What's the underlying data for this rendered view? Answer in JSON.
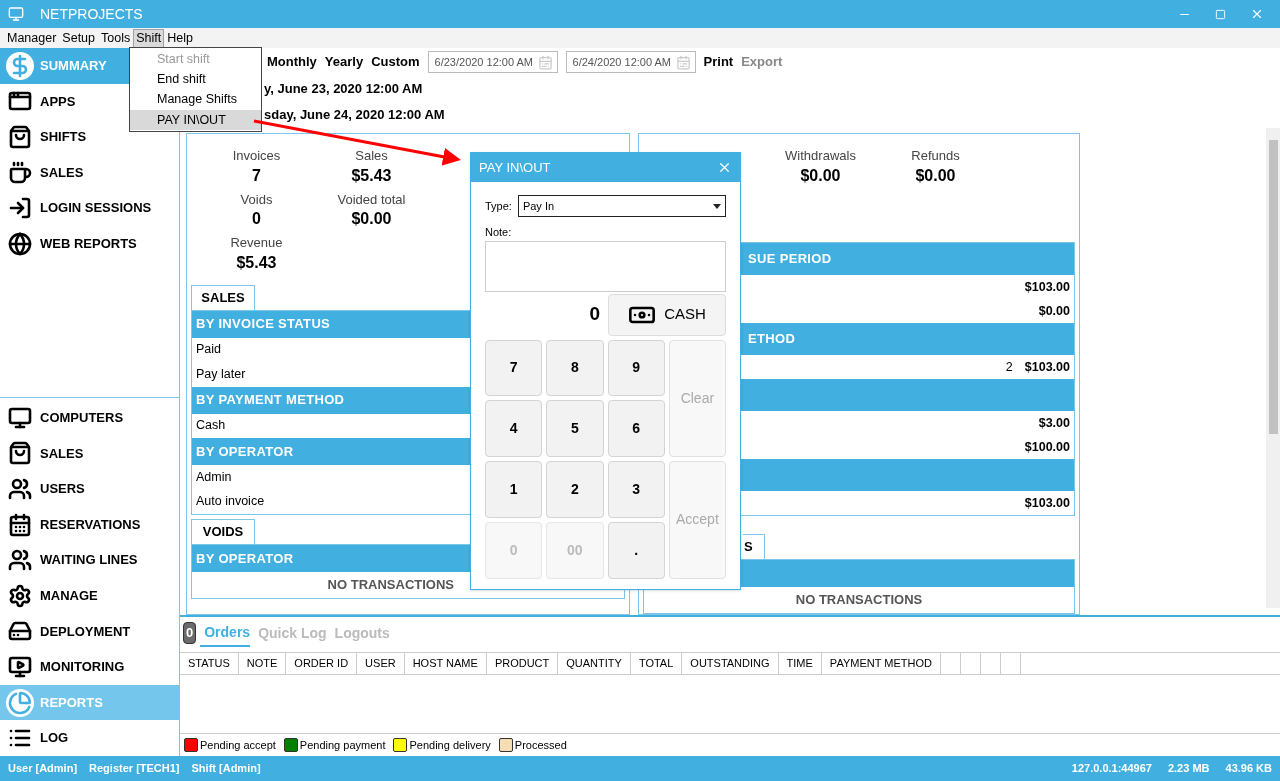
{
  "window": {
    "title": "NETPROJECTS"
  },
  "menu_bar": [
    {
      "label": "Manager",
      "selected": false
    },
    {
      "label": "Setup",
      "selected": false
    },
    {
      "label": "Tools",
      "selected": false
    },
    {
      "label": "Shift",
      "selected": true
    },
    {
      "label": "Help",
      "selected": false
    }
  ],
  "shift_menu": [
    {
      "label": "Start shift",
      "disabled": true,
      "selected": false
    },
    {
      "label": "End shift",
      "disabled": false,
      "selected": false
    },
    {
      "label": "Manage Shifts",
      "disabled": false,
      "selected": false
    },
    {
      "label": "PAY IN\\OUT",
      "disabled": false,
      "selected": true
    }
  ],
  "sidebar": {
    "top_items": [
      {
        "label": "SUMMARY",
        "selected": true
      },
      {
        "label": "APPS",
        "selected": false
      },
      {
        "label": "SHIFTS",
        "selected": false
      },
      {
        "label": "SALES",
        "selected": false
      },
      {
        "label": "LOGIN SESSIONS",
        "selected": false
      },
      {
        "label": "WEB REPORTS",
        "selected": false
      }
    ],
    "bottom_items": [
      {
        "label": "COMPUTERS",
        "selected": false
      },
      {
        "label": "SALES",
        "selected": false
      },
      {
        "label": "USERS",
        "selected": false
      },
      {
        "label": "RESERVATIONS",
        "selected": false
      },
      {
        "label": "WAITING LINES",
        "selected": false
      },
      {
        "label": "MANAGE",
        "selected": false
      },
      {
        "label": "DEPLOYMENT",
        "selected": false
      },
      {
        "label": "MONITORING",
        "selected": false
      },
      {
        "label": "REPORTS",
        "selected": true
      },
      {
        "label": "LOG",
        "selected": false
      }
    ]
  },
  "toolbar": {
    "periods": [
      "Monthly",
      "Yearly",
      "Custom"
    ],
    "start_date": "6/23/2020 12:00 AM",
    "end_date": "6/24/2020 12:00 AM",
    "actions": [
      {
        "label": "Print",
        "disabled": false
      },
      {
        "label": "Export",
        "disabled": true
      }
    ]
  },
  "period_lines": [
    "y, June 23, 2020 12:00 AM",
    "sday, June 24, 2020 12:00 AM"
  ],
  "left_panel": {
    "stats": [
      [
        {
          "label": "Invoices",
          "value": "7"
        },
        {
          "label": "Sales",
          "value": "$5.43"
        }
      ],
      [
        {
          "label": "Voids",
          "value": "0"
        },
        {
          "label": "Voided total",
          "value": "$0.00"
        }
      ],
      [
        {
          "label": "Revenue",
          "value": "$5.43"
        }
      ]
    ],
    "sections": [
      {
        "tab": "SALES",
        "groups": [
          {
            "title": "BY INVOICE STATUS",
            "rows": [
              "Paid",
              "Pay later"
            ]
          },
          {
            "title": "BY PAYMENT METHOD",
            "rows": [
              "Cash"
            ]
          },
          {
            "title": "BY OPERATOR",
            "rows": [
              "Admin",
              "Auto invoice"
            ]
          }
        ]
      },
      {
        "tab": "VOIDS",
        "groups": [
          {
            "title": "BY OPERATOR"
          }
        ],
        "empty": "NO TRANSACTIONS"
      }
    ]
  },
  "right_panel": {
    "stats": [
      {
        "label": "Withdrawals",
        "value": "$0.00"
      },
      {
        "label": "Refunds",
        "value": "$0.00"
      }
    ],
    "groups": [
      {
        "title": "SUE PERIOD",
        "rows": [
          [
            "$103.00"
          ],
          [
            "$0.00"
          ]
        ]
      },
      {
        "title": "ETHOD",
        "rows": [
          [
            "2",
            "$103.00"
          ]
        ]
      },
      {
        "rows": [
          [
            "$3.00"
          ],
          [
            "$100.00"
          ]
        ]
      },
      {
        "rows": [
          [
            "$103.00"
          ]
        ]
      }
    ],
    "second_section": {
      "tab": "S",
      "empty": "NO TRANSACTIONS"
    }
  },
  "dialog": {
    "title": "PAY IN\\OUT",
    "type_label": "Type:",
    "type_value": "Pay In",
    "note_label": "Note:",
    "amount": "0",
    "cash_button": "CASH",
    "keys": [
      {
        "label": "7",
        "disabled": false
      },
      {
        "label": "8",
        "disabled": false
      },
      {
        "label": "9",
        "disabled": false
      },
      {
        "label": "4",
        "disabled": false
      },
      {
        "label": "5",
        "disabled": false
      },
      {
        "label": "6",
        "disabled": false
      },
      {
        "label": "1",
        "disabled": false
      },
      {
        "label": "2",
        "disabled": false
      },
      {
        "label": "3",
        "disabled": false
      },
      {
        "label": "0",
        "disabled": true
      },
      {
        "label": "00",
        "disabled": true
      },
      {
        "label": ".",
        "disabled": false
      }
    ],
    "clear": {
      "label": "Clear",
      "disabled": true
    },
    "accept": {
      "label": "Accept",
      "disabled": true
    }
  },
  "log_tabs": {
    "count": "0",
    "tabs": [
      {
        "label": "Orders",
        "selected": true
      },
      {
        "label": "Quick Log",
        "selected": false
      },
      {
        "label": "Logouts",
        "selected": false
      }
    ]
  },
  "orders_table": {
    "columns": [
      "STATUS",
      "NOTE",
      "ORDER ID",
      "USER",
      "HOST NAME",
      "PRODUCT",
      "QUANTITY",
      "TOTAL",
      "OUTSTANDING",
      "TIME",
      "PAYMENT METHOD"
    ]
  },
  "legend": [
    {
      "label": "Pending accept",
      "color": "#ff0000"
    },
    {
      "label": "Pending payment",
      "color": "#008000"
    },
    {
      "label": "Pending delivery",
      "color": "#ffff00"
    },
    {
      "label": "Processed",
      "color": "#f5deb3"
    }
  ],
  "status_bar": {
    "left": [
      "User [Admin]",
      "Register [TECH1]",
      "Shift [Admin]"
    ],
    "right": [
      "127.0.0.1:44967",
      "2.23 MB",
      "43.96 KB"
    ]
  }
}
